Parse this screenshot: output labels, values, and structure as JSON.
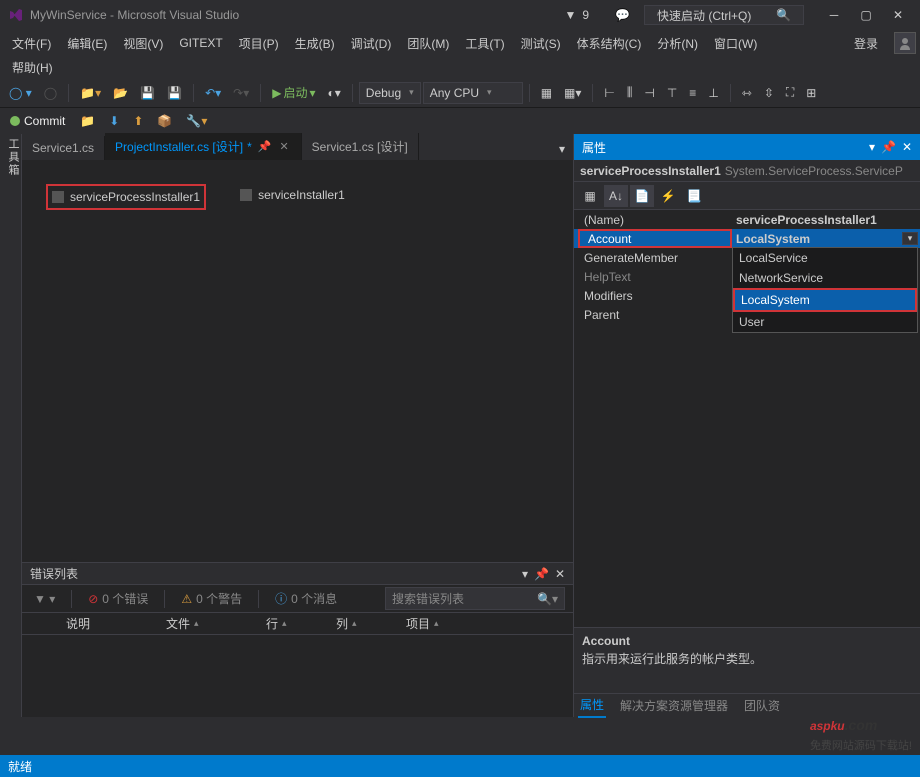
{
  "title": "MyWinService - Microsoft Visual Studio",
  "notif_count": "9",
  "quick_launch_placeholder": "快速启动 (Ctrl+Q)",
  "menus": [
    "文件(F)",
    "编辑(E)",
    "视图(V)",
    "GITEXT",
    "项目(P)",
    "生成(B)",
    "调试(D)",
    "团队(M)",
    "工具(T)",
    "测试(S)",
    "体系结构(C)",
    "分析(N)",
    "窗口(W)"
  ],
  "login": "登录",
  "help_menu": "帮助(H)",
  "toolbar": {
    "start": "启动",
    "config": "Debug",
    "platform": "Any CPU"
  },
  "commit": "Commit",
  "left_tab": "工具箱",
  "tabs": [
    {
      "label": "Service1.cs",
      "active": false,
      "dirty": false
    },
    {
      "label": "ProjectInstaller.cs [设计]",
      "active": true,
      "dirty": true
    },
    {
      "label": "Service1.cs [设计]",
      "active": false,
      "dirty": false
    }
  ],
  "components": [
    {
      "name": "serviceProcessInstaller1",
      "selected": true
    },
    {
      "name": "serviceInstaller1",
      "selected": false
    }
  ],
  "errorlist": {
    "title": "错误列表",
    "errors": "0 个错误",
    "warnings": "0 个警告",
    "messages": "0 个消息",
    "search_placeholder": "搜索错误列表",
    "cols": [
      "说明",
      "文件",
      "行",
      "列",
      "项目"
    ]
  },
  "properties": {
    "title": "属性",
    "obj_name": "serviceProcessInstaller1",
    "obj_type": "System.ServiceProcess.ServiceP",
    "rows": [
      {
        "name": "(Name)",
        "val": "serviceProcessInstaller1",
        "bold": true
      },
      {
        "name": "Account",
        "val": "LocalSystem",
        "selected": true
      },
      {
        "name": "GenerateMember",
        "val": ""
      },
      {
        "name": "HelpText",
        "val": "",
        "dim": true
      },
      {
        "name": "Modifiers",
        "val": ""
      },
      {
        "name": "Parent",
        "val": ""
      }
    ],
    "dropdown": [
      "LocalService",
      "NetworkService",
      "LocalSystem",
      "User"
    ],
    "dropdown_sel": "LocalSystem",
    "desc_name": "Account",
    "desc_text": "指示用来运行此服务的帐户类型。",
    "tabs": [
      "属性",
      "解决方案资源管理器",
      "团队资"
    ]
  },
  "status": "就绪",
  "watermark": {
    "main": "aspku",
    "dom": ".com",
    "sub": "免费网站源码下载站!"
  }
}
